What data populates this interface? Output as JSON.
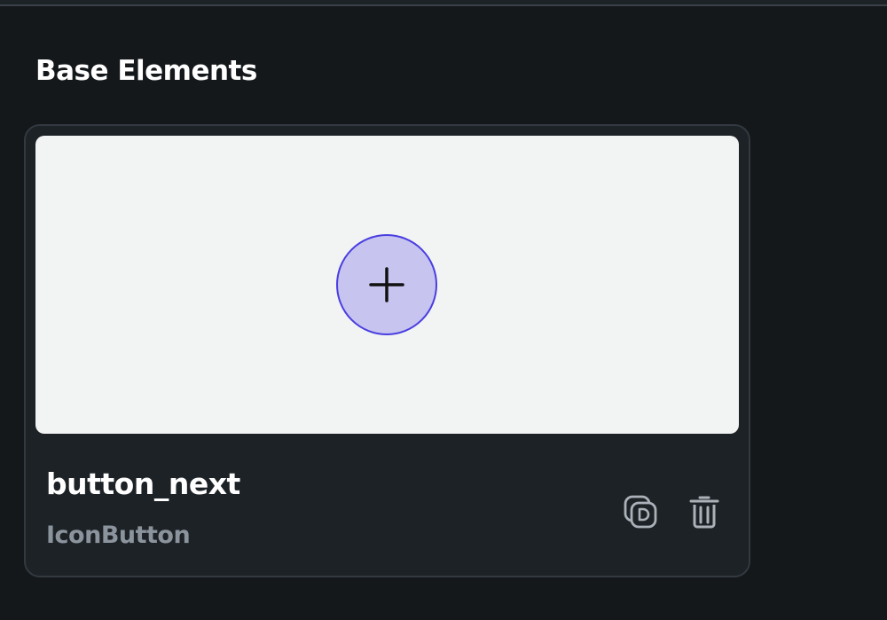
{
  "section": {
    "title": "Base Elements"
  },
  "element_card": {
    "name": "button_next",
    "type": "IconButton",
    "preview": {
      "icon": "plus-icon",
      "button_fill": "#c7c4f0",
      "button_border": "#4a3ee0",
      "background": "#f2f4f3"
    },
    "actions": [
      {
        "icon": "duplicate-icon"
      },
      {
        "icon": "trash-icon"
      }
    ]
  },
  "colors": {
    "page_background": "#14181b",
    "card_background": "#1d2226",
    "card_border": "#323940",
    "subtitle_text": "#8b939c",
    "icon_color": "#aab1b8"
  }
}
